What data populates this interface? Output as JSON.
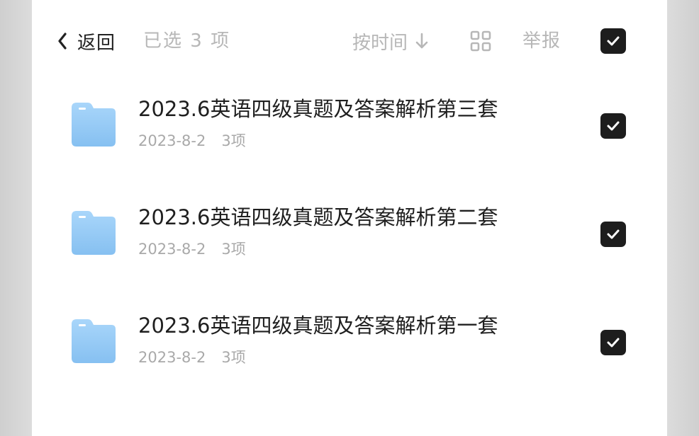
{
  "header": {
    "back_label": "返回",
    "selected_label": "已选 3 项",
    "sort_label": "按时间",
    "report_label": "举报"
  },
  "icons": {
    "back": "chevron-left-icon",
    "sort_direction": "arrow-down-icon",
    "view_toggle": "grid-icon",
    "check": "check-icon",
    "folder": "folder-icon"
  },
  "colors": {
    "checkbox": "#1d1d1d",
    "folder": "#8ec5f3",
    "muted_text": "#b7b7b7"
  },
  "select_all_checked": true,
  "files": [
    {
      "name": "2023.6英语四级真题及答案解析第三套",
      "date": "2023-8-2",
      "count": "3项",
      "checked": true
    },
    {
      "name": "2023.6英语四级真题及答案解析第二套",
      "date": "2023-8-2",
      "count": "3项",
      "checked": true
    },
    {
      "name": "2023.6英语四级真题及答案解析第一套",
      "date": "2023-8-2",
      "count": "3项",
      "checked": true
    }
  ]
}
